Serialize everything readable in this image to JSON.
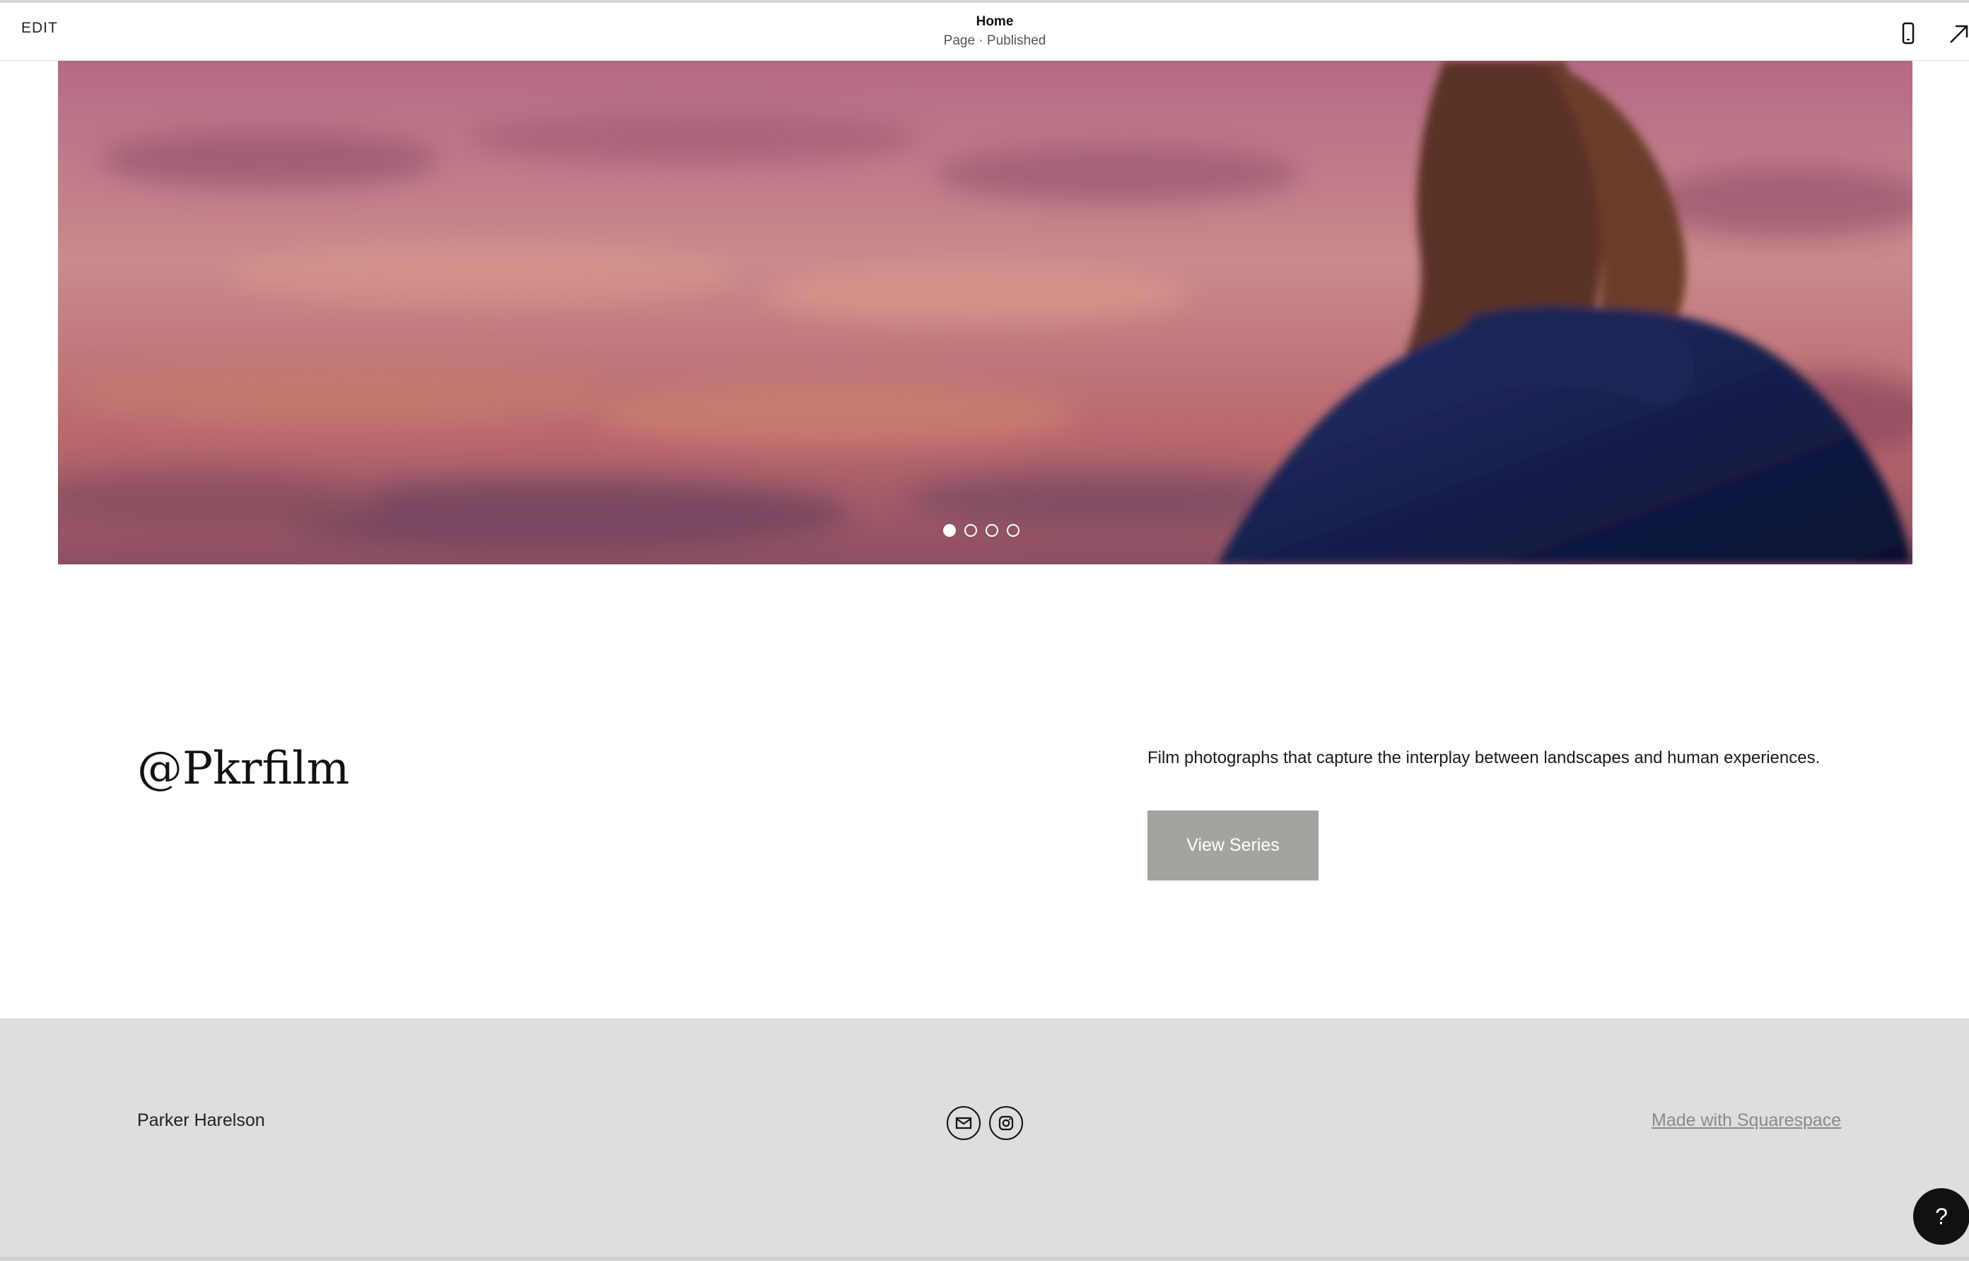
{
  "editor": {
    "edit_label": "EDIT",
    "page_title": "Home",
    "page_status": "Page · Published",
    "mobile_icon": "mobile-preview-icon",
    "open_icon": "arrow-up-right-icon"
  },
  "hero": {
    "slide_count": 4,
    "active_slide": 1
  },
  "intro": {
    "handle": "@Pkrfilm",
    "tagline": "Film photographs that capture the interplay between landscapes and human experiences.",
    "button_label": "View Series"
  },
  "footer": {
    "name": "Parker Harelson",
    "social_icons": [
      "email-icon",
      "instagram-icon"
    ],
    "made_with": "Made with Squarespace"
  },
  "help": {
    "label": "?"
  },
  "colors": {
    "button_bg": "#a4a39d",
    "footer_bg": "#dddedf",
    "help_bg": "#111111"
  }
}
